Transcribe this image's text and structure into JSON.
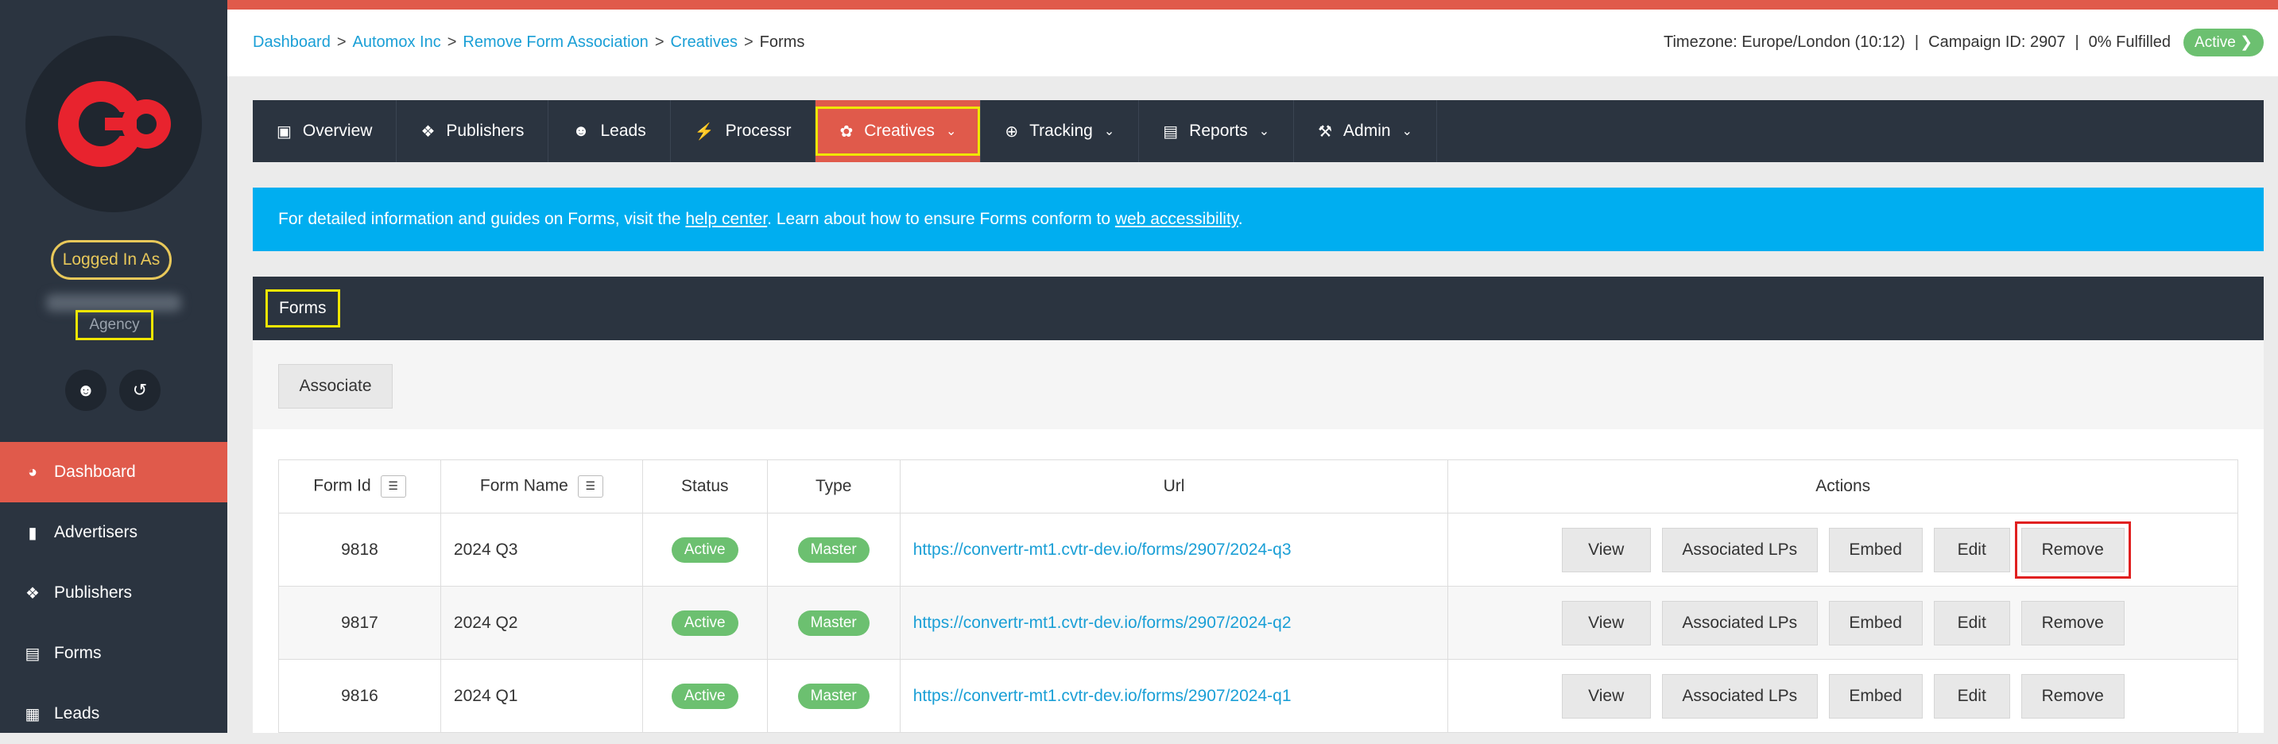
{
  "sidebar": {
    "logged_in_label": "Logged In As",
    "agency_label": "Agency",
    "profile_icon": "user-icon",
    "switch_icon": "switch-account-icon",
    "nav": [
      {
        "label": "Dashboard",
        "icon": "dashboard-icon",
        "active": true
      },
      {
        "label": "Advertisers",
        "icon": "advertisers-icon"
      },
      {
        "label": "Publishers",
        "icon": "publishers-icon"
      },
      {
        "label": "Forms",
        "icon": "forms-icon"
      },
      {
        "label": "Leads",
        "icon": "leads-icon"
      }
    ]
  },
  "topbar": {
    "breadcrumb": [
      "Dashboard",
      "Automox Inc",
      "Remove Form Association",
      "Creatives",
      "Forms"
    ],
    "timezone": "Timezone: Europe/London (10:12)",
    "campaign": "Campaign ID: 2907",
    "fulfilled": "0% Fulfilled",
    "status": "Active"
  },
  "tabs": [
    {
      "label": "Overview",
      "icon": "overview-icon"
    },
    {
      "label": "Publishers",
      "icon": "publishers-icon"
    },
    {
      "label": "Leads",
      "icon": "leads-icon"
    },
    {
      "label": "Processr",
      "icon": "bolt-icon"
    },
    {
      "label": "Creatives",
      "icon": "palette-icon",
      "active": true,
      "dropdown": true
    },
    {
      "label": "Tracking",
      "icon": "crosshair-icon",
      "dropdown": true
    },
    {
      "label": "Reports",
      "icon": "report-icon",
      "dropdown": true
    },
    {
      "label": "Admin",
      "icon": "wrench-icon",
      "dropdown": true
    }
  ],
  "banner": {
    "pre": "For detailed information and guides on Forms, visit the ",
    "link1": "help center",
    "mid": ". Learn about how to ensure Forms conform to ",
    "link2": "web accessibility",
    "post": "."
  },
  "panel": {
    "title": "Forms",
    "associate_label": "Associate",
    "columns": [
      "Form Id",
      "Form Name",
      "Status",
      "Type",
      "Url",
      "Actions"
    ],
    "action_labels": [
      "View",
      "Associated LPs",
      "Embed",
      "Edit",
      "Remove"
    ],
    "rows": [
      {
        "id": "9818",
        "name": "2024 Q3",
        "status": "Active",
        "type": "Master",
        "url": "https://convertr-mt1.cvtr-dev.io/forms/2907/2024-q3"
      },
      {
        "id": "9817",
        "name": "2024 Q2",
        "status": "Active",
        "type": "Master",
        "url": "https://convertr-mt1.cvtr-dev.io/forms/2907/2024-q2"
      },
      {
        "id": "9816",
        "name": "2024 Q1",
        "status": "Active",
        "type": "Master",
        "url": "https://convertr-mt1.cvtr-dev.io/forms/2907/2024-q1"
      }
    ]
  },
  "colors": {
    "accent": "#e05a4b",
    "nav_dark": "#2b3440",
    "banner": "#00aef0",
    "status_green": "#6cc070",
    "highlight_yellow": "#f0e600",
    "highlight_red": "#e02020"
  }
}
